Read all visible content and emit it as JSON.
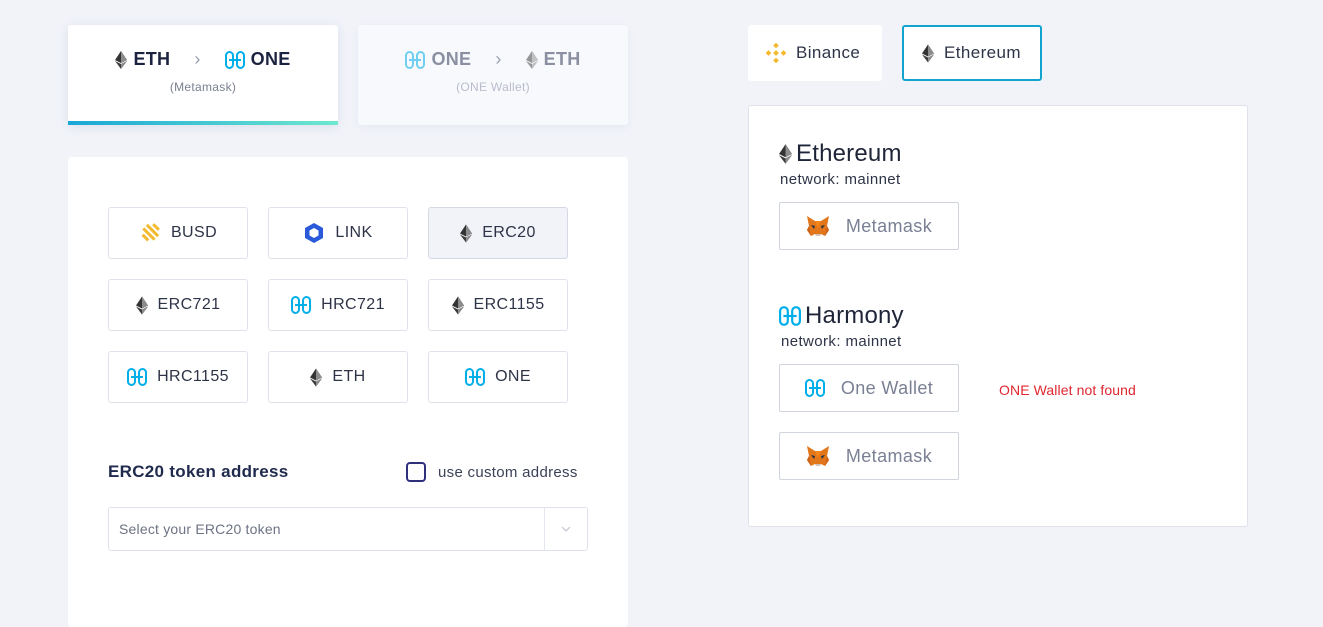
{
  "directions": [
    {
      "from": "ETH",
      "to": "ONE",
      "wallet": "(Metamask)",
      "active": true
    },
    {
      "from": "ONE",
      "to": "ETH",
      "wallet": "(ONE Wallet)",
      "active": false
    }
  ],
  "arrow": "›",
  "tokens": [
    {
      "label": "BUSD",
      "icon": "busd-icon"
    },
    {
      "label": "LINK",
      "icon": "chainlink-icon"
    },
    {
      "label": "ERC20",
      "icon": "ethereum-icon",
      "selected": true
    },
    {
      "label": "ERC721",
      "icon": "ethereum-icon"
    },
    {
      "label": "HRC721",
      "icon": "harmony-icon"
    },
    {
      "label": "ERC1155",
      "icon": "ethereum-icon"
    },
    {
      "label": "HRC1155",
      "icon": "harmony-icon"
    },
    {
      "label": "ETH",
      "icon": "ethereum-icon"
    },
    {
      "label": "ONE",
      "icon": "harmony-icon"
    }
  ],
  "address": {
    "title": "ERC20 token address",
    "custom_label": "use custom address",
    "custom_checked": false,
    "placeholder": "Select your ERC20 token"
  },
  "network_tabs": [
    {
      "label": "Binance",
      "icon": "binance-icon",
      "active": false
    },
    {
      "label": "Ethereum",
      "icon": "ethereum-icon",
      "active": true
    }
  ],
  "networks": {
    "ethereum": {
      "name": "Ethereum",
      "network": "network: mainnet",
      "wallets": [
        {
          "label": "Metamask",
          "icon": "metamask-fox-icon"
        }
      ]
    },
    "harmony": {
      "name": "Harmony",
      "network": "network: mainnet",
      "wallets": [
        {
          "label": "One Wallet",
          "icon": "harmony-icon",
          "error": "ONE Wallet not found"
        },
        {
          "label": "Metamask",
          "icon": "metamask-fox-icon"
        }
      ]
    }
  },
  "colors": {
    "accent": "#12a4cf",
    "harmony": "#00aee9",
    "error": "#e0262f",
    "binance": "#f3ba2f",
    "chainlink": "#2a5ada"
  }
}
